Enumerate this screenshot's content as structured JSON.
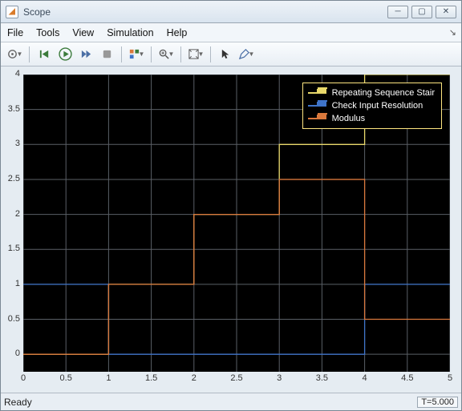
{
  "window": {
    "title": "Scope",
    "icon_letter": "📈"
  },
  "menu": {
    "items": [
      "File",
      "Tools",
      "View",
      "Simulation",
      "Help"
    ]
  },
  "toolbar": {
    "buttons": [
      "config",
      "step-back",
      "run",
      "step-forward",
      "stop",
      "highlight",
      "zoom",
      "autoscale",
      "cursor",
      "settings"
    ]
  },
  "statusbar": {
    "ready": "Ready",
    "time": "T=5.000"
  },
  "chart_data": {
    "type": "line",
    "x": [
      0,
      0.5,
      1,
      1.5,
      2,
      2.5,
      3,
      3.5,
      4,
      4.5,
      5
    ],
    "xlim": [
      0,
      5
    ],
    "ylim": [
      -0.25,
      4
    ],
    "xticks": [
      0,
      0.5,
      1,
      1.5,
      2,
      2.5,
      3,
      3.5,
      4,
      4.5,
      5
    ],
    "yticks": [
      0,
      0.5,
      1,
      1.5,
      2,
      2.5,
      3,
      3.5,
      4
    ],
    "series": [
      {
        "name": "Repeating Sequence Stair",
        "color": "#e8d86a",
        "step_x": [
          0,
          1,
          1,
          2,
          2,
          3,
          3,
          4,
          4,
          5
        ],
        "step_y": [
          0,
          0,
          1,
          1,
          2,
          2,
          3,
          3,
          4,
          4
        ]
      },
      {
        "name": "Check Input  Resolution",
        "color": "#3f74c9",
        "step_x": [
          0,
          1,
          1,
          4,
          4,
          5
        ],
        "step_y": [
          1,
          1,
          0,
          0,
          1,
          1
        ]
      },
      {
        "name": "Modulus",
        "color": "#d9783c",
        "step_x": [
          0,
          1,
          1,
          2,
          2,
          3,
          3,
          4,
          4,
          5
        ],
        "step_y": [
          0,
          0,
          1,
          1,
          2,
          2,
          2.5,
          2.5,
          0.5,
          0.5
        ]
      }
    ],
    "legend": {
      "position": "top-right"
    }
  }
}
